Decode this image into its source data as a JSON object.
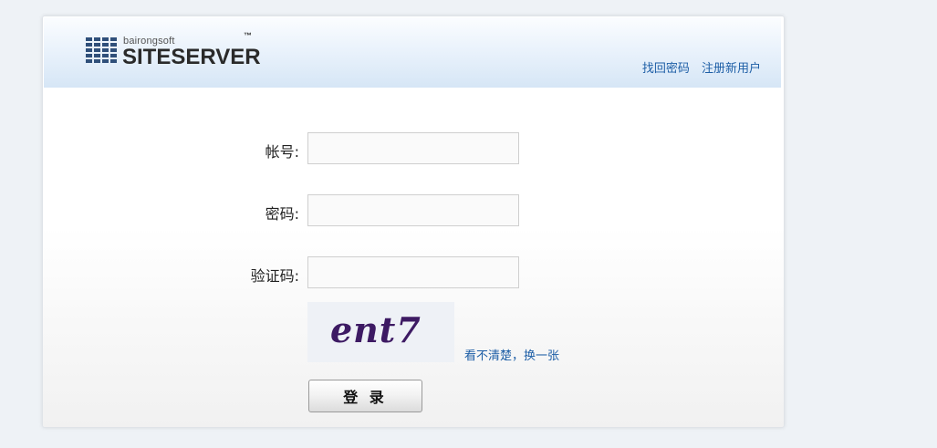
{
  "header": {
    "logo": {
      "small_text": "bairongsoft",
      "big_text": "SITESERVER",
      "tm": "™"
    },
    "links": {
      "forgot_password": "找回密码",
      "register": "注册新用户"
    }
  },
  "form": {
    "account_label": "帐号:",
    "account_value": "",
    "password_label": "密码:",
    "password_value": "",
    "captcha_label": "验证码:",
    "captcha_value": "",
    "captcha_image_text": "ent7",
    "captcha_refresh": "看不清楚，换一张",
    "login_button": "登 录"
  },
  "colors": {
    "link": "#1d5ea6",
    "captcha_text": "#3d1a63",
    "header_gradient_end": "#d6e6f6"
  }
}
